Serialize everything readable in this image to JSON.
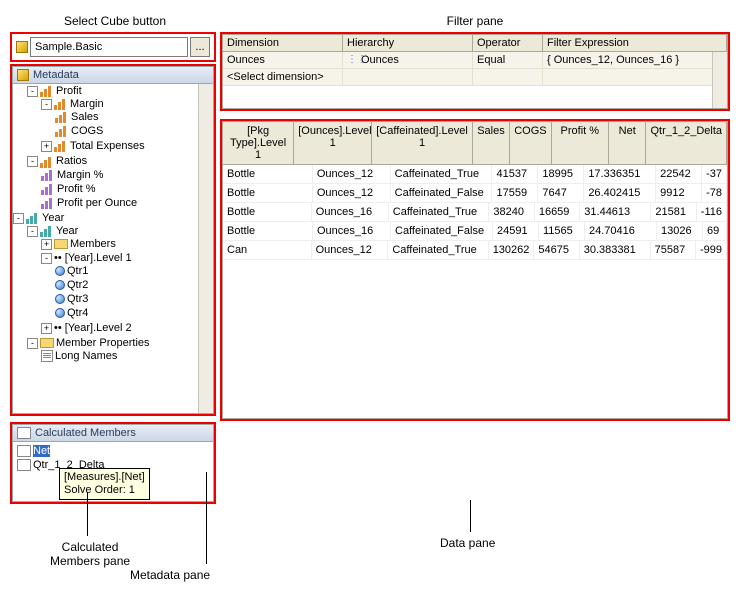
{
  "annotations": {
    "select_cube": "Select Cube button",
    "filter_pane": "Filter pane",
    "data_pane": "Data pane",
    "metadata_pane": "Metadata pane",
    "calc_pane": "Calculated\nMembers pane"
  },
  "cube": {
    "name": "Sample.Basic",
    "button": "..."
  },
  "metadata": {
    "title": "Metadata",
    "tree": {
      "profit": "Profit",
      "margin": "Margin",
      "sales": "Sales",
      "cogs": "COGS",
      "total_expenses": "Total Expenses",
      "ratios": "Ratios",
      "margin_pct": "Margin %",
      "profit_pct": "Profit %",
      "profit_per_ounce": "Profit per Ounce",
      "year": "Year",
      "year2": "Year",
      "members": "Members",
      "year_level1": "[Year].Level 1",
      "qtr1": "Qtr1",
      "qtr2": "Qtr2",
      "qtr3": "Qtr3",
      "qtr4": "Qtr4",
      "year_level2": "[Year].Level 2",
      "member_props": "Member Properties",
      "long_names": "Long Names"
    }
  },
  "calc": {
    "title": "Calculated Members",
    "items": {
      "net": "Net",
      "qtr": "Qtr_1_2_Delta"
    },
    "tooltip_l1": "[Measures].[Net]",
    "tooltip_l2": "Solve Order: 1"
  },
  "filter": {
    "headers": {
      "dim": "Dimension",
      "hier": "Hierarchy",
      "op": "Operator",
      "exp": "Filter Expression"
    },
    "rows": [
      {
        "dim": "Ounces",
        "hier": "Ounces",
        "op": "Equal",
        "exp": "{ Ounces_12, Ounces_16 }"
      }
    ],
    "placeholder": "<Select dimension>"
  },
  "data": {
    "headers": [
      "[Pkg Type].Level 1",
      "[Ounces].Level 1",
      "[Caffeinated].Level 1",
      "Sales",
      "COGS",
      "Profit %",
      "Net",
      "Qtr_1_2_Delta"
    ],
    "rows": [
      [
        "Bottle",
        "Ounces_12",
        "Caffeinated_True",
        "41537",
        "18995",
        "17.336351",
        "22542",
        "-37"
      ],
      [
        "Bottle",
        "Ounces_12",
        "Caffeinated_False",
        "17559",
        "7647",
        "26.402415",
        "9912",
        "-78"
      ],
      [
        "Bottle",
        "Ounces_16",
        "Caffeinated_True",
        "38240",
        "16659",
        "31.44613",
        "21581",
        "-116"
      ],
      [
        "Bottle",
        "Ounces_16",
        "Caffeinated_False",
        "24591",
        "11565",
        "24.70416",
        "13026",
        "69"
      ],
      [
        "Can",
        "Ounces_12",
        "Caffeinated_True",
        "130262",
        "54675",
        "30.383381",
        "75587",
        "-999"
      ]
    ]
  }
}
